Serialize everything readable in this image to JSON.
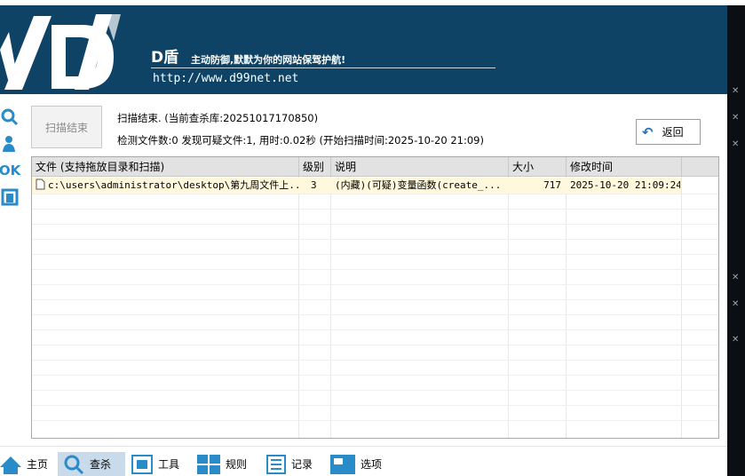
{
  "banner": {
    "brand": "D盾",
    "slogan": "主动防御,默默为你的网站保驾护航!",
    "url": "http://www.d99net.net"
  },
  "left_tools": [
    "search-icon",
    "user-icon",
    "ok-icon",
    "window-icon"
  ],
  "left_tools_ok_label": "OK",
  "scan_button": "扫描结束",
  "status": {
    "line1": "扫描结束. (当前查杀库:20251017170850)",
    "line2": "检测文件数:0 发现可疑文件:1, 用时:0.02秒 (开始扫描时间:2025-10-20 21:09)"
  },
  "back_button": "返回",
  "table": {
    "columns": [
      "文件 (支持拖放目录和扫描)",
      "级别",
      "说明",
      "大小",
      "修改时间"
    ],
    "rows": [
      {
        "file": "c:\\users\\administrator\\desktop\\第九周文件上...",
        "level": "3",
        "desc": "(内藏)(可疑)变量函数(create_...",
        "size": "717",
        "mtime": "2025-10-20 21:09:24"
      }
    ]
  },
  "nav": [
    {
      "label": "主页",
      "icon": "home-icon"
    },
    {
      "label": "查杀",
      "icon": "search-icon",
      "active": true
    },
    {
      "label": "工具",
      "icon": "tools-icon"
    },
    {
      "label": "规则",
      "icon": "rules-icon"
    },
    {
      "label": "记录",
      "icon": "log-icon"
    },
    {
      "label": "选项",
      "icon": "options-icon"
    }
  ],
  "colors": {
    "banner": "#0e4366",
    "accent": "#2a8bc9",
    "selected_row": "#fff8dc",
    "active_nav": "#c9daea"
  }
}
